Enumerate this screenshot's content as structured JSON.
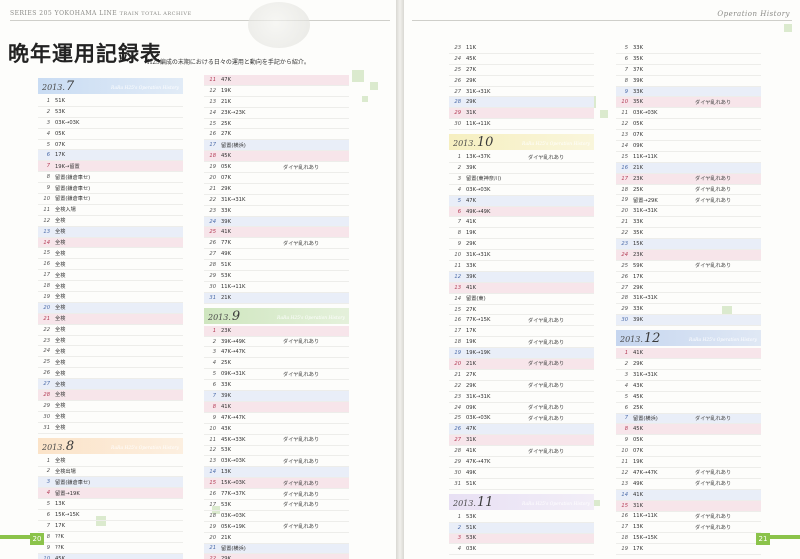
{
  "header": {
    "series_label": "SERIES 205 YOKOHAMA LINE",
    "archive_label": "TRAIN TOTAL ARCHIVE",
    "section_label": "Operation History"
  },
  "title": "晩年運用記録表",
  "subtitle": "H25編成の末期における日々の運用と動向を手記から紹介。",
  "page_numbers": {
    "left": "20",
    "right": "21"
  },
  "colors": {
    "jul": "#c9dcf3",
    "aug": "#fbe3c8",
    "sep": "#cfe6bf",
    "oct": "#f6efc0",
    "nov": "#e8e0f4",
    "dec": "#c6d6ef"
  },
  "months": {
    "jul": {
      "year": "2013.",
      "month": "7",
      "tag": "RaRa H25's Operation History",
      "rows": [
        [
          "1",
          "51K",
          ""
        ],
        [
          "2",
          "53K",
          ""
        ],
        [
          "3",
          "03K→03K",
          ""
        ],
        [
          "4",
          "05K",
          ""
        ],
        [
          "5",
          "07K",
          ""
        ],
        [
          "6",
          "17K",
          ""
        ],
        [
          "7",
          "19K→留置",
          ""
        ],
        [
          "8",
          "留置(鎌倉車セ)",
          ""
        ],
        [
          "9",
          "留置(鎌倉車セ)",
          ""
        ],
        [
          "10",
          "留置(鎌倉車セ)",
          ""
        ],
        [
          "11",
          "全検入場",
          ""
        ],
        [
          "12",
          "全検",
          ""
        ],
        [
          "13",
          "全検",
          ""
        ],
        [
          "14",
          "全検",
          ""
        ],
        [
          "15",
          "全検",
          ""
        ],
        [
          "16",
          "全検",
          ""
        ],
        [
          "17",
          "全検",
          ""
        ],
        [
          "18",
          "全検",
          ""
        ],
        [
          "19",
          "全検",
          ""
        ],
        [
          "20",
          "全検",
          ""
        ],
        [
          "21",
          "全検",
          ""
        ],
        [
          "22",
          "全検",
          ""
        ],
        [
          "23",
          "全検",
          ""
        ],
        [
          "24",
          "全検",
          ""
        ],
        [
          "25",
          "全検",
          ""
        ],
        [
          "26",
          "全検",
          ""
        ],
        [
          "27",
          "全検",
          ""
        ],
        [
          "28",
          "全検",
          ""
        ],
        [
          "29",
          "全検",
          ""
        ],
        [
          "30",
          "全検",
          ""
        ],
        [
          "31",
          "全検",
          ""
        ]
      ]
    },
    "aug": {
      "year": "2013.",
      "month": "8",
      "tag": "RaRa H25's Operation History",
      "rows": [
        [
          "1",
          "全検",
          ""
        ],
        [
          "2",
          "全検出場",
          ""
        ],
        [
          "3",
          "留置(鎌倉車セ)",
          ""
        ],
        [
          "4",
          "留置→19K",
          ""
        ],
        [
          "5",
          "13K",
          ""
        ],
        [
          "6",
          "15K→15K",
          ""
        ],
        [
          "7",
          "17K",
          ""
        ],
        [
          "8",
          "??K",
          ""
        ],
        [
          "9",
          "??K",
          ""
        ],
        [
          "10",
          "45K",
          ""
        ]
      ]
    },
    "aug2": {
      "rows": [
        [
          "11",
          "47K",
          ""
        ],
        [
          "12",
          "19K",
          ""
        ],
        [
          "13",
          "21K",
          ""
        ],
        [
          "14",
          "23K→23K",
          ""
        ],
        [
          "15",
          "25K",
          ""
        ],
        [
          "16",
          "27K",
          ""
        ],
        [
          "17",
          "留置(横浜)",
          ""
        ],
        [
          "18",
          "45K",
          ""
        ],
        [
          "19",
          "05K",
          "ダイヤ乱れあり"
        ],
        [
          "20",
          "07K",
          ""
        ],
        [
          "21",
          "29K",
          ""
        ],
        [
          "22",
          "31K→31K",
          ""
        ],
        [
          "23",
          "33K",
          ""
        ],
        [
          "24",
          "39K",
          ""
        ],
        [
          "25",
          "41K",
          ""
        ],
        [
          "26",
          "77K",
          "ダイヤ乱れあり"
        ],
        [
          "27",
          "49K",
          ""
        ],
        [
          "28",
          "51K",
          ""
        ],
        [
          "29",
          "53K",
          ""
        ],
        [
          "30",
          "11K→11K",
          ""
        ],
        [
          "31",
          "21K",
          ""
        ]
      ]
    },
    "sep": {
      "year": "2013.",
      "month": "9",
      "tag": "RaRa H25's Operation History",
      "rows": [
        [
          "1",
          "23K",
          ""
        ],
        [
          "2",
          "39K→49K",
          "ダイヤ乱れあり"
        ],
        [
          "3",
          "47K→47K",
          ""
        ],
        [
          "4",
          "25K",
          ""
        ],
        [
          "5",
          "09K→31K",
          "ダイヤ乱れあり"
        ],
        [
          "6",
          "33K",
          ""
        ],
        [
          "7",
          "39K",
          ""
        ],
        [
          "8",
          "41K",
          ""
        ],
        [
          "9",
          "47K→47K",
          ""
        ],
        [
          "10",
          "43K",
          ""
        ],
        [
          "11",
          "45K→33K",
          "ダイヤ乱れあり"
        ],
        [
          "12",
          "53K",
          ""
        ],
        [
          "13",
          "03K→03K",
          "ダイヤ乱れあり"
        ],
        [
          "14",
          "13K",
          ""
        ],
        [
          "15",
          "15K→03K",
          "ダイヤ乱れあり"
        ],
        [
          "16",
          "77K→37K",
          "ダイヤ乱れあり"
        ],
        [
          "17",
          "53K",
          "ダイヤ乱れあり"
        ],
        [
          "18",
          "03K→03K",
          ""
        ],
        [
          "19",
          "05K→19K",
          "ダイヤ乱れあり"
        ],
        [
          "20",
          "21K",
          ""
        ],
        [
          "21",
          "留置(横浜)",
          ""
        ],
        [
          "22",
          "29K",
          ""
        ]
      ]
    },
    "sep2": {
      "rows": [
        [
          "23",
          "11K",
          ""
        ],
        [
          "24",
          "45K",
          ""
        ],
        [
          "25",
          "27K",
          ""
        ],
        [
          "26",
          "29K",
          ""
        ],
        [
          "27",
          "31K→31K",
          ""
        ],
        [
          "28",
          "29K",
          ""
        ],
        [
          "29",
          "31K",
          ""
        ],
        [
          "30",
          "11K→11K",
          ""
        ]
      ]
    },
    "oct": {
      "year": "2013.",
      "month": "10",
      "tag": "RaRa H25's Operation History",
      "rows": [
        [
          "1",
          "13K→37K",
          "ダイヤ乱れあり"
        ],
        [
          "2",
          "39K",
          ""
        ],
        [
          "3",
          "留置(東神奈川)",
          ""
        ],
        [
          "4",
          "03K→03K",
          ""
        ],
        [
          "5",
          "47K",
          ""
        ],
        [
          "6",
          "49K→49K",
          ""
        ],
        [
          "7",
          "41K",
          ""
        ],
        [
          "8",
          "19K",
          ""
        ],
        [
          "9",
          "29K",
          ""
        ],
        [
          "10",
          "31K→31K",
          ""
        ],
        [
          "11",
          "33K",
          ""
        ],
        [
          "12",
          "39K",
          ""
        ],
        [
          "13",
          "41K",
          ""
        ],
        [
          "14",
          "留置(東)",
          ""
        ],
        [
          "15",
          "27K",
          ""
        ],
        [
          "16",
          "77K→15K",
          "ダイヤ乱れあり"
        ],
        [
          "17",
          "17K",
          ""
        ],
        [
          "18",
          "19K",
          "ダイヤ乱れあり"
        ],
        [
          "19",
          "19K→19K",
          ""
        ],
        [
          "20",
          "21K",
          "ダイヤ乱れあり"
        ],
        [
          "21",
          "27K",
          ""
        ],
        [
          "22",
          "29K",
          "ダイヤ乱れあり"
        ],
        [
          "23",
          "31K→31K",
          ""
        ],
        [
          "24",
          "09K",
          "ダイヤ乱れあり"
        ],
        [
          "25",
          "03K→03K",
          "ダイヤ乱れあり"
        ],
        [
          "26",
          "47K",
          ""
        ],
        [
          "27",
          "31K",
          ""
        ],
        [
          "28",
          "41K",
          "ダイヤ乱れあり"
        ],
        [
          "29",
          "47K→47K",
          ""
        ],
        [
          "30",
          "49K",
          ""
        ],
        [
          "31",
          "51K",
          ""
        ]
      ]
    },
    "nov": {
      "year": "2013.",
      "month": "11",
      "tag": "RaRa H25's Operation History",
      "rows": [
        [
          "1",
          "53K",
          ""
        ],
        [
          "2",
          "51K",
          ""
        ],
        [
          "3",
          "53K",
          ""
        ],
        [
          "4",
          "03K",
          ""
        ]
      ]
    },
    "nov2": {
      "rows": [
        [
          "5",
          "33K",
          ""
        ],
        [
          "6",
          "35K",
          ""
        ],
        [
          "7",
          "37K",
          ""
        ],
        [
          "8",
          "39K",
          ""
        ],
        [
          "9",
          "33K",
          ""
        ],
        [
          "10",
          "35K",
          "ダイヤ乱れあり"
        ],
        [
          "11",
          "03K→03K",
          ""
        ],
        [
          "12",
          "05K",
          ""
        ],
        [
          "13",
          "07K",
          ""
        ],
        [
          "14",
          "09K",
          ""
        ],
        [
          "15",
          "11K→11K",
          ""
        ],
        [
          "16",
          "21K",
          ""
        ],
        [
          "17",
          "23K",
          "ダイヤ乱れあり"
        ],
        [
          "18",
          "25K",
          "ダイヤ乱れあり"
        ],
        [
          "19",
          "留置→29K",
          "ダイヤ乱れあり"
        ],
        [
          "20",
          "31K→31K",
          ""
        ],
        [
          "21",
          "33K",
          ""
        ],
        [
          "22",
          "35K",
          ""
        ],
        [
          "23",
          "15K",
          ""
        ],
        [
          "24",
          "23K",
          ""
        ],
        [
          "25",
          "59K",
          "ダイヤ乱れあり"
        ],
        [
          "26",
          "17K",
          ""
        ],
        [
          "27",
          "29K",
          ""
        ],
        [
          "28",
          "31K→31K",
          ""
        ],
        [
          "29",
          "33K",
          ""
        ],
        [
          "30",
          "39K",
          ""
        ]
      ]
    },
    "dec": {
      "year": "2013.",
      "month": "12",
      "tag": "RaRa H25's Operation History",
      "rows": [
        [
          "1",
          "41K",
          ""
        ],
        [
          "2",
          "29K",
          ""
        ],
        [
          "3",
          "31K→31K",
          ""
        ],
        [
          "4",
          "43K",
          ""
        ],
        [
          "5",
          "45K",
          ""
        ],
        [
          "6",
          "25K",
          ""
        ],
        [
          "7",
          "留置(横浜)",
          "ダイヤ乱れあり"
        ],
        [
          "8",
          "45K",
          ""
        ],
        [
          "9",
          "05K",
          ""
        ],
        [
          "10",
          "07K",
          ""
        ],
        [
          "11",
          "19K",
          ""
        ],
        [
          "12",
          "47K→47K",
          "ダイヤ乱れあり"
        ],
        [
          "13",
          "49K",
          "ダイヤ乱れあり"
        ],
        [
          "14",
          "41K",
          ""
        ],
        [
          "15",
          "31K",
          ""
        ],
        [
          "16",
          "11K→11K",
          "ダイヤ乱れあり"
        ],
        [
          "17",
          "13K",
          "ダイヤ乱れあり"
        ],
        [
          "18",
          "15K→15K",
          ""
        ],
        [
          "19",
          "17K",
          ""
        ]
      ]
    }
  }
}
